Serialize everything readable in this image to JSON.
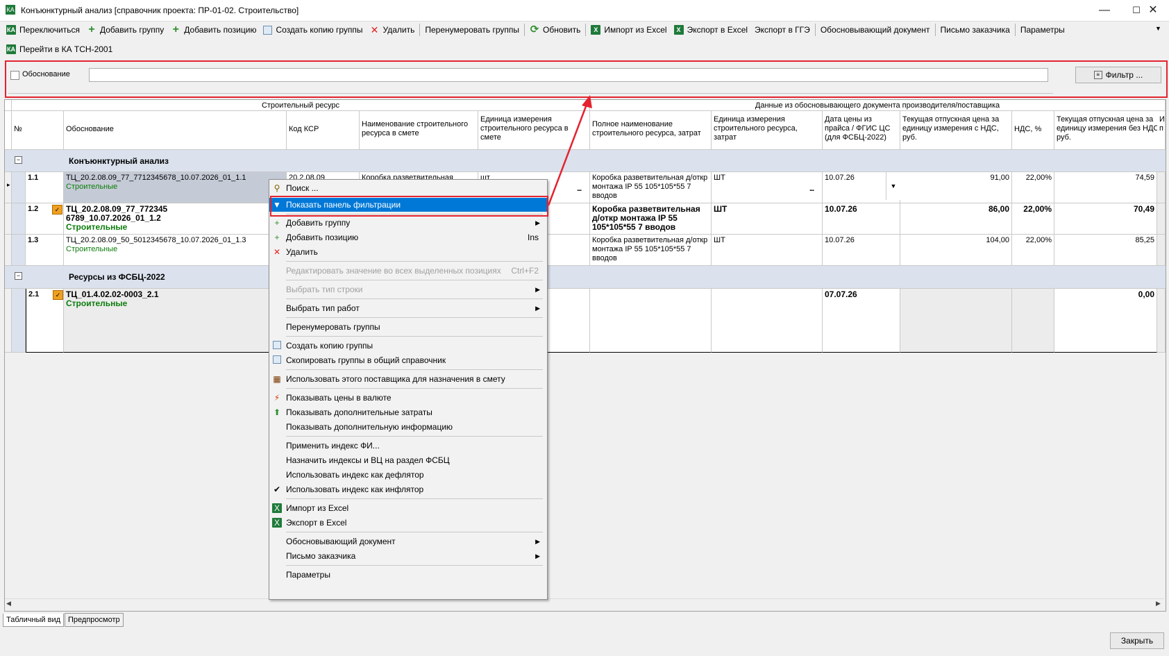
{
  "window": {
    "title": "Конъюнктурный анализ [справочник проекта: ПР-01-02. Строительство]"
  },
  "toolbar1": [
    {
      "label": "Переключиться",
      "icon": "excel-icon"
    },
    {
      "label": "Добавить группу",
      "icon": "add-icon"
    },
    {
      "label": "Добавить позицию",
      "icon": "add-icon"
    },
    {
      "label": "Создать копию группы",
      "icon": "copy-icon"
    },
    {
      "label": "Удалить",
      "icon": "delete-icon"
    },
    {
      "label": "Перенумеровать группы",
      "icon": ""
    },
    {
      "label": "Обновить",
      "icon": "refresh-icon"
    },
    {
      "label": "Импорт из Excel",
      "icon": "excel-icon"
    },
    {
      "label": "Экспорт в Excel",
      "icon": "excel-icon"
    },
    {
      "label": "Экспорт в ГГЭ",
      "icon": ""
    },
    {
      "label": "Обосновывающий документ",
      "icon": ""
    },
    {
      "label": "Письмо заказчика",
      "icon": ""
    },
    {
      "label": "Параметры",
      "icon": ""
    }
  ],
  "toolbar2": {
    "goto_label": "Перейти в КА ТСН-2001"
  },
  "filter": {
    "checkbox_label": "Обоснование",
    "input_value": "",
    "button_label": "Фильтр ..."
  },
  "grid": {
    "band_left": "Строительный ресурс",
    "band_right": "Данные из обосновывающего документа производителя/поставщика",
    "headers": {
      "num": "№",
      "basis": "Обоснование",
      "ksr": "Код КСР",
      "name": "Наименование строительного ресурса в смете",
      "unit": "Единица измерения строительного ресурса в смете",
      "fullname": "Полное наименование строительного ресурса, затрат",
      "unit2": "Единица измерения строительного ресурса, затрат",
      "date": "Дата цены из прайса / ФГИС ЦС (для ФСБЦ-2022)",
      "price_vat": "Текущая отпускная цена за единицу измерения с НДС, руб.",
      "vat": "НДС, %",
      "price_novat": "Текущая отпускная цена за единицу измерения без НДС, руб.",
      "extra": "И п"
    },
    "group1": "Конъюнктурный анализ",
    "group2": "Ресурсы из ФСБЦ-2022",
    "rows": [
      {
        "num": "1.1",
        "basis": "ТЦ_20.2.08.09_77_7712345678_10.07.2026_01_1.1",
        "type": "Строительные",
        "ksr": "20.2.08.09",
        "name": "Коробка разветвительная",
        "unit": "шт",
        "fullname": "Коробка разветвительная д/откр монтажа IP 55 105*105*55 7 вводов",
        "unit2": "ШТ",
        "date": "10.07.26",
        "price_vat": "91,00",
        "vat": "22,00%",
        "price_novat": "74,59"
      },
      {
        "num": "1.2",
        "basis": "ТЦ_20.2.08.09_77_772345 6789_10.07.2026_01_1.2",
        "type": "Строительные",
        "ksr": "",
        "name": "",
        "unit": "",
        "fullname": "Коробка разветвительная д/откр монтажа IP 55 105*105*55 7 вводов",
        "unit2": "ШТ",
        "date": "10.07.26",
        "price_vat": "86,00",
        "vat": "22,00%",
        "price_novat": "70,49"
      },
      {
        "num": "1.3",
        "basis": "ТЦ_20.2.08.09_50_5012345678_10.07.2026_01_1.3",
        "type": "Строительные",
        "ksr": "",
        "name": "",
        "unit": "",
        "fullname": "Коробка разветвительная д/откр монтажа IP 55 105*105*55 7 вводов",
        "unit2": "ШТ",
        "date": "10.07.26",
        "price_vat": "104,00",
        "vat": "22,00%",
        "price_novat": "85,25"
      },
      {
        "num": "2.1",
        "basis": "ТЦ_01.4.02.02-0003_2.1",
        "type": "Строительные",
        "ksr": "",
        "name": "",
        "unit": "",
        "fullname": "",
        "unit2": "",
        "date": "07.07.26",
        "price_vat": "",
        "vat": "",
        "price_novat": "0,00"
      }
    ]
  },
  "context_menu": {
    "search": "Поиск ...",
    "show_filter": "Показать панель фильтрации",
    "add_group": "Добавить группу",
    "add_position": "Добавить позицию",
    "add_position_shortcut": "Ins",
    "delete": "Удалить",
    "edit_all": "Редактировать значение во всех выделенных позициях",
    "edit_all_shortcut": "Ctrl+F2",
    "select_row_type": "Выбрать тип строки",
    "select_work_type": "Выбрать тип работ",
    "renumber": "Перенумеровать группы",
    "copy_group": "Создать копию группы",
    "copy_to_common": "Скопировать группы в общий справочник",
    "use_supplier": "Использовать этого поставщика для назначения в смету",
    "show_currency": "Показывать цены в валюте",
    "show_extra_costs": "Показывать дополнительные затраты",
    "show_extra_info": "Показывать дополнительную информацию",
    "apply_index": "Применить индекс ФИ...",
    "assign_index": "Назначить индексы и ВЦ на раздел ФСБЦ",
    "use_deflator": "Использовать индекс как дефлятор",
    "use_inflator": "Использовать индекс как инфлятор",
    "import_excel": "Импорт из Excel",
    "export_excel": "Экспорт в Excel",
    "basis_doc": "Обосновывающий документ",
    "customer_letter": "Письмо заказчика",
    "params": "Параметры"
  },
  "tabs": [
    "Табличный вид",
    "Предпросмотр"
  ],
  "footer": {
    "close_label": "Закрыть"
  },
  "colors": {
    "highlight": "#0078d7",
    "annotation": "#e3232f",
    "group_bg": "#dbe2ee",
    "green_text": "#0b7d0b"
  }
}
